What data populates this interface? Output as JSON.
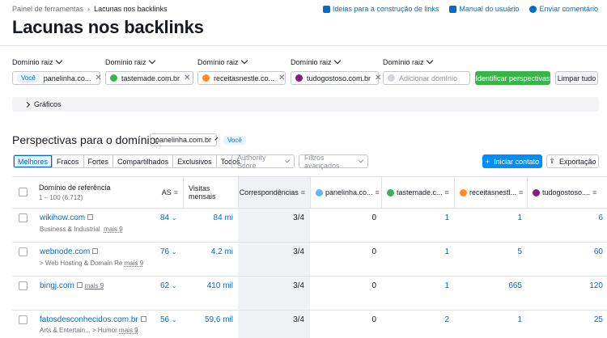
{
  "breadcrumb": {
    "root": "Painel de ferramentas",
    "current": "Lacunas nos backlinks"
  },
  "toplinks": [
    "Ideias para a construção de links",
    "Manual do usuário",
    "Enviar comentário"
  ],
  "title": "Lacunas nos backlinks",
  "domain_label": "Domínio raiz",
  "you_badge": "Você",
  "domains": [
    {
      "name": "panelinha.co...",
      "color": ""
    },
    {
      "name": "tastemade.com.br",
      "color": "#3ab44a"
    },
    {
      "name": "receitasnestle.co...",
      "color": "#ff8c25"
    },
    {
      "name": "tudogostoso.com.br",
      "color": "#8a1a8c"
    }
  ],
  "add_domain_placeholder": "Adicionar domínio",
  "identify_button": "Identificar perspectivas",
  "clear_button": "Limpar tudo",
  "graphs_label": "Gráficos",
  "perspectives_label": "Perspectivas para o domínio:",
  "perspectives_domain": "panelinha.com.br",
  "tabs": [
    "Melhores",
    "Fracos",
    "Fortes",
    "Compartilhados",
    "Exclusivos",
    "Todos"
  ],
  "authority_filter": "Authority Score",
  "advanced_filter": "Filtros avançados",
  "start_contact": "Iniciar contato",
  "export": "Exportação",
  "columns": {
    "ref_domain": "Domínio de referência",
    "range": "1 – 100 (6.712)",
    "as": "AS",
    "visits": "Visitas mensais",
    "matches": "Correspondências",
    "c1": "panelinha.co...",
    "c2": "tastemade.c...",
    "c3": "receitasnestl...",
    "c4": "tudogostoso...."
  },
  "rows": [
    {
      "domain": "wikihow.com",
      "category": "Business & Industrial",
      "more": "mais 9",
      "as": "84",
      "visits": "84 mi",
      "matches": "3/4",
      "v1": "0",
      "v2": "1",
      "v3": "1",
      "v4": "6"
    },
    {
      "domain": "webnode.com",
      "category": "> Web Hosting & Domain Re",
      "more": "mais 9",
      "as": "76",
      "visits": "4,2 mi",
      "matches": "3/4",
      "v1": "0",
      "v2": "1",
      "v3": "5",
      "v4": "60"
    },
    {
      "domain": "bingj.com",
      "category": "",
      "more": "mais 9",
      "as": "62",
      "visits": "410 mil",
      "matches": "3/4",
      "v1": "0",
      "v2": "1",
      "v3": "665",
      "v4": "120"
    },
    {
      "domain": "fatosdesconhecidos.com.br",
      "category": "Arts & Entertain...  > Humor",
      "more": "mais 9",
      "as": "56",
      "visits": "59,6 mil",
      "matches": "3/4",
      "v1": "0",
      "v2": "2",
      "v3": "1",
      "v4": "25"
    }
  ]
}
